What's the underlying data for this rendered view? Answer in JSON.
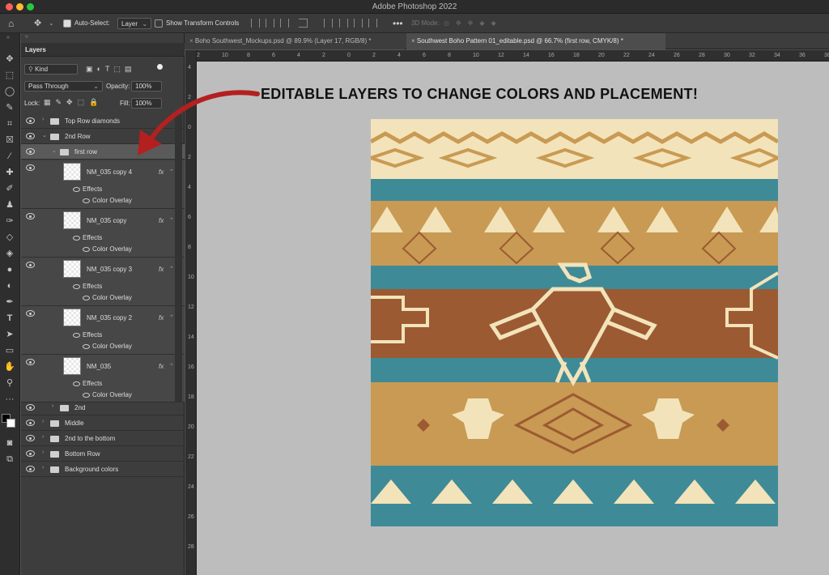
{
  "app": {
    "title": "Adobe Photoshop 2022"
  },
  "options_bar": {
    "auto_select_label": "Auto-Select:",
    "auto_select_value": "Layer",
    "transform_controls_label": "Show Transform Controls",
    "three_d_mode_label": "3D Mode:"
  },
  "tabs": [
    {
      "label": "Boho Southwest_Mockups.psd @ 89.9% (Layer 17, RGB/8) *"
    },
    {
      "label": "Southwest Boho Pattern 01_editable.psd @ 66.7% (first row, CMYK/8) *"
    }
  ],
  "layers_panel": {
    "title": "Layers",
    "filter_kind": "Kind",
    "blend_mode": "Pass Through",
    "opacity_label": "Opacity:",
    "opacity_value": "100%",
    "lock_label": "Lock:",
    "fill_label": "Fill:",
    "fill_value": "100%",
    "groups_top": [
      {
        "name": "Top Row diamonds"
      },
      {
        "name": "2nd Row"
      },
      {
        "name": "first row"
      }
    ],
    "layers": [
      {
        "name": "NM_035 copy 4",
        "effects": "Effects",
        "effect": "Color Overlay"
      },
      {
        "name": "NM_035 copy",
        "effects": "Effects",
        "effect": "Color Overlay"
      },
      {
        "name": "NM_035 copy 3",
        "effects": "Effects",
        "effect": "Color Overlay"
      },
      {
        "name": "NM_035 copy 2",
        "effects": "Effects",
        "effect": "Color Overlay"
      },
      {
        "name": "NM_035",
        "effects": "Effects",
        "effect": "Color Overlay"
      }
    ],
    "groups_bottom": [
      {
        "name": "2nd"
      },
      {
        "name": "Middle"
      },
      {
        "name": "2nd to the bottom"
      },
      {
        "name": "Bottom Row"
      },
      {
        "name": "Background colors"
      }
    ],
    "fx_symbol": "fx"
  },
  "ruler": {
    "h_ticks": [
      "2",
      "10",
      "8",
      "6",
      "4",
      "2",
      "0",
      "2",
      "4",
      "6",
      "8",
      "10",
      "12",
      "14",
      "16",
      "18",
      "20",
      "22",
      "24",
      "26",
      "28",
      "30",
      "32",
      "34",
      "36",
      "38"
    ],
    "v_ticks": [
      "4",
      "2",
      "0",
      "2",
      "4",
      "6",
      "8",
      "10",
      "12",
      "14",
      "16",
      "18",
      "20",
      "22",
      "24",
      "26",
      "28"
    ]
  },
  "annotation": {
    "text": "EDITABLE LAYERS TO CHANGE COLORS AND PLACEMENT!"
  },
  "colors": {
    "cream": "#f2e3ba",
    "gold": "#c99a53",
    "teal": "#3f8a97",
    "rust": "#9c5a32",
    "annotation_arrow": "#b3201f"
  }
}
